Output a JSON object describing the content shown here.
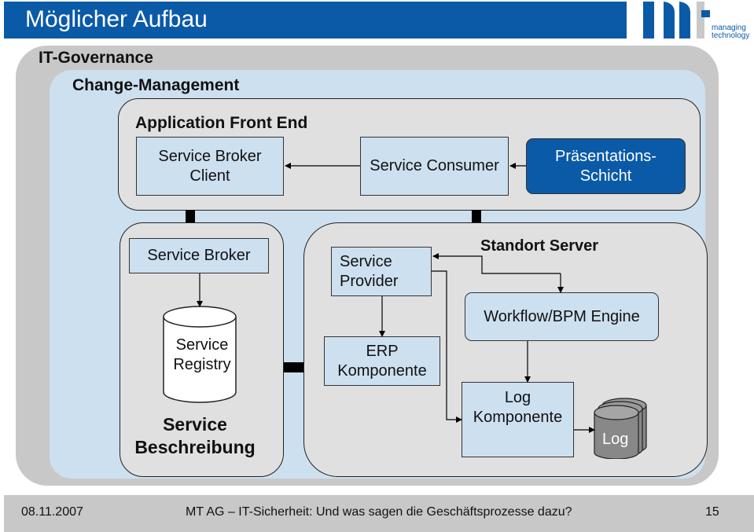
{
  "header": {
    "title": "Möglicher Aufbau",
    "logo": {
      "text_line1": "managing",
      "text_line2": "technology",
      "brand": "mt",
      "color": "#0a5aa8"
    }
  },
  "layers": {
    "governance": "IT-Governance",
    "change_management": "Change-Management"
  },
  "front_end": {
    "title": "Application Front End",
    "boxes": {
      "broker_client": [
        "Service Broker",
        "Client"
      ],
      "consumer": "Service Consumer",
      "presentation": [
        "Präsentations-",
        "Schicht"
      ]
    }
  },
  "service_description": {
    "title": [
      "Service",
      "Beschreibung"
    ],
    "broker": "Service Broker",
    "registry": [
      "Service",
      "Registry"
    ]
  },
  "site_server": {
    "title": "Standort Server",
    "provider": [
      "Service",
      "Provider"
    ],
    "erp": [
      "ERP",
      "Komponente"
    ],
    "workflow": "Workflow/BPM Engine",
    "log_component": [
      "Log",
      "Komponente"
    ],
    "log_store": "Log"
  },
  "colors": {
    "brand_blue": "#0a5aa8",
    "light_blue": "#cde0f0",
    "panel_gray": "#e0e0e0",
    "frame_gray": "#c8c8c8"
  },
  "footer": {
    "date": "08.11.2007",
    "text": "MT AG –  IT-Sicherheit: Und was sagen die Geschäftsprozesse dazu?",
    "page": "15"
  }
}
